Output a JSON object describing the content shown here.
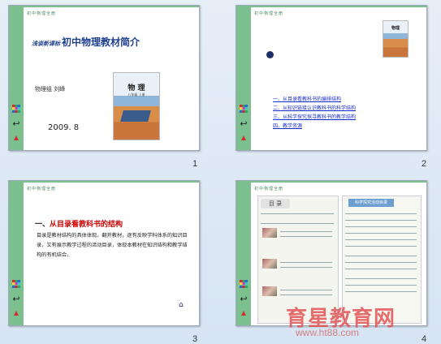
{
  "slides": [
    {
      "number": "1",
      "header": "初中物理全册",
      "title_prefix": "浅谈新课标",
      "title": "初中物理教材简介",
      "author": "物理组 刘峰",
      "date": "2009. 8",
      "book_title": "物 理",
      "book_subtitle": "八年级 上册"
    },
    {
      "number": "2",
      "header": "初中物理全册",
      "book_title": "物理",
      "items": [
        "一、从目录看教科书的编排结构",
        "二、从知识链接认识教科书的科学结构",
        "三、从科学探究探寻教科书的教学结构",
        "四、教学资源"
      ]
    },
    {
      "number": "3",
      "header": "初中物理全册",
      "heading_prefix": "一、",
      "heading": "从目录看教科书的结构",
      "body": "目录是教材结构的具体体现。翻开教材，逐有反映学科体系的知识目录，又有展示教学过程的活动目录，体现本教材在知识结构和教学结构的有机结合。"
    },
    {
      "number": "4",
      "header": "初中物理全册",
      "left_tab": "目 录",
      "right_tab": "科学探究活动目录"
    }
  ],
  "watermark": {
    "text": "育星教育网",
    "url": "www.ht88.com"
  },
  "icons": [
    "mosaic-icon",
    "hook-icon",
    "runner-icon",
    "home-icon"
  ]
}
